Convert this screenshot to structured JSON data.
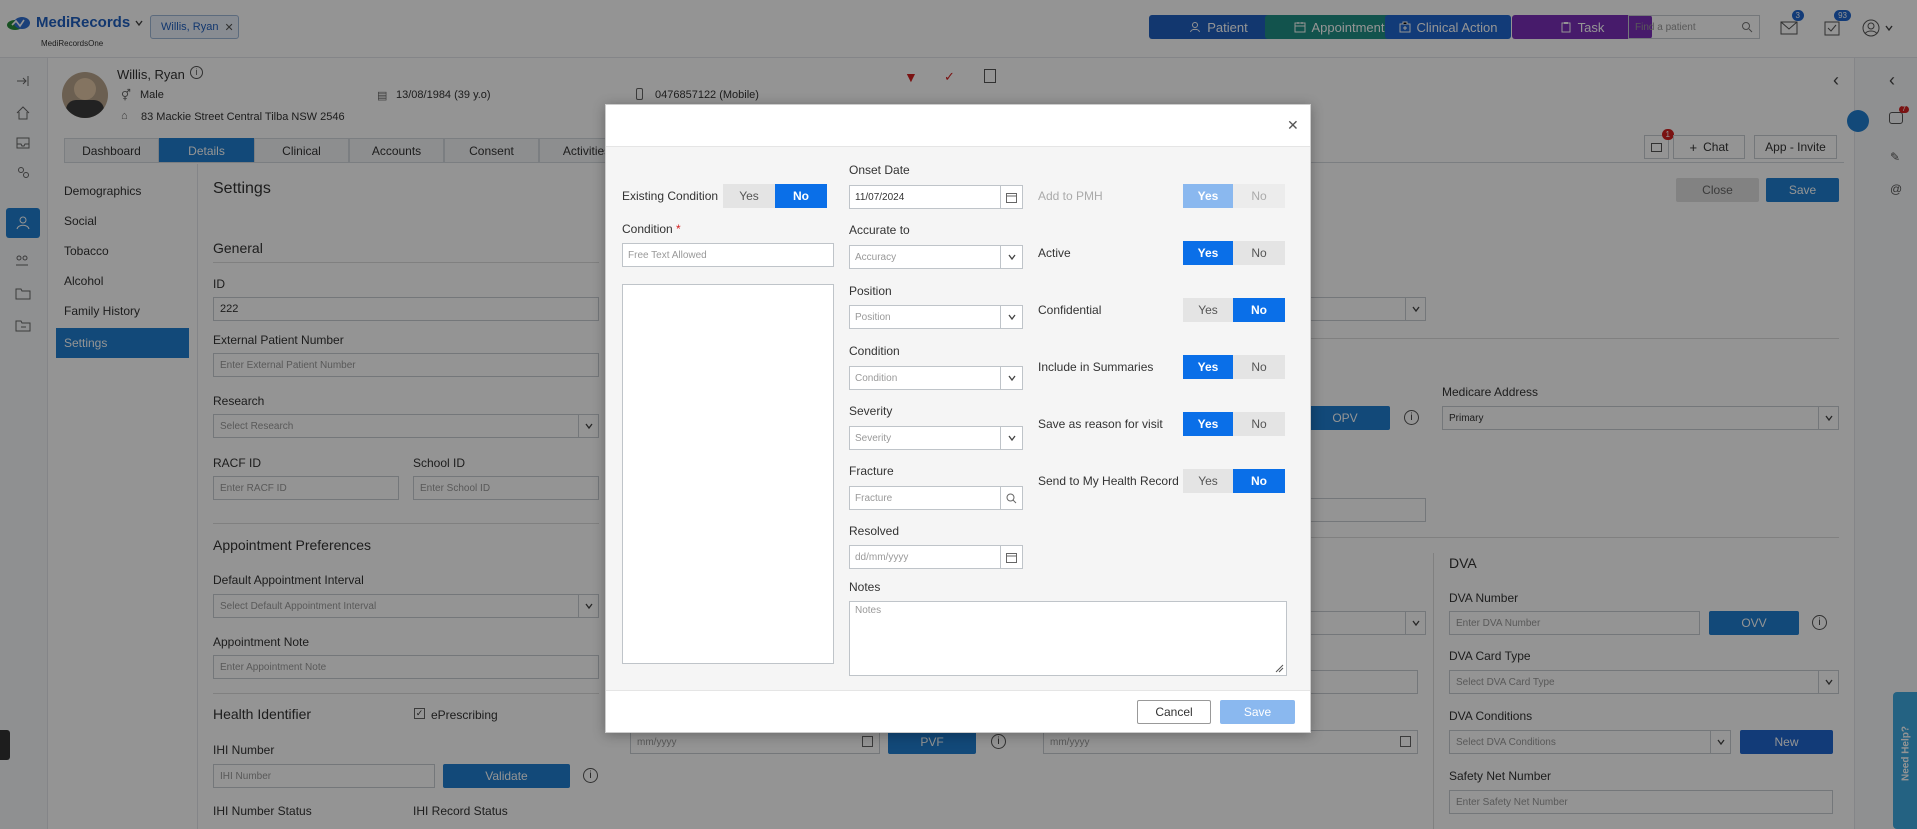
{
  "app": {
    "brand": "MediRecords",
    "sub_brand": "MediRecordsOne",
    "patient_tab": "Willis, Ryan"
  },
  "topbar": {
    "buttons": [
      {
        "label": "Patient",
        "color": "#1f5fbf"
      },
      {
        "label": "Appointment",
        "color": "#1f8f85"
      },
      {
        "label": "Clinical Action",
        "color": "#1f66cf"
      },
      {
        "label": "Task",
        "color": "#7a2fb8"
      }
    ],
    "search_placeholder": "Find a patient",
    "mail_badge": "3",
    "tasks_badge": "93"
  },
  "patient": {
    "name": "Willis, Ryan",
    "gender": "Male",
    "dob": "13/08/1984 (39 y.o)",
    "phone": "0476857122 (Mobile)",
    "address": "83 Mackie Street Central Tilba NSW 2546"
  },
  "tabs": [
    "Dashboard",
    "Details",
    "Clinical",
    "Accounts",
    "Consent",
    "Activities"
  ],
  "header_actions": {
    "chat": "Chat",
    "app_invite": "App - Invite",
    "notif_badge": "1"
  },
  "right_rail_badge": "7",
  "subnav": [
    "Demographics",
    "Social",
    "Tobacco",
    "Alcohol",
    "Family History",
    "Settings"
  ],
  "settings": {
    "title": "Settings",
    "close": "Close",
    "save": "Save",
    "general": "General",
    "id_label": "ID",
    "id_value": "222",
    "ext_label": "External Patient Number",
    "ext_ph": "Enter External Patient Number",
    "research_label": "Research",
    "research_ph": "Select Research",
    "racf_label": "RACF ID",
    "racf_ph": "Enter RACF ID",
    "school_label": "School ID",
    "school_ph": "Enter School ID",
    "appt_pref": "Appointment Preferences",
    "interval_label": "Default Appointment Interval",
    "interval_ph": "Select Default Appointment Interval",
    "note_label": "Appointment Note",
    "note_ph": "Enter Appointment Note",
    "health_id": "Health Identifier",
    "eprescribing": "ePrescribing",
    "ihi_label": "IHI Number",
    "ihi_ph": "IHI Number",
    "validate": "Validate",
    "ihi_status": "IHI Number Status",
    "ihi_record": "IHI Record Status",
    "opv": "OPV",
    "medicare_addr_label": "Medicare Address",
    "medicare_addr_value": "Primary",
    "dva": "DVA",
    "dva_num_label": "DVA Number",
    "dva_num_ph": "Enter DVA Number",
    "ovv": "OVV",
    "dva_card_label": "DVA Card Type",
    "dva_card_ph": "Select DVA Card Type",
    "dva_cond_label": "DVA Conditions",
    "dva_cond_ph": "Select DVA Conditions",
    "new": "New",
    "safety_label": "Safety Net Number",
    "safety_ph": "Enter Safety Net Number",
    "mmyyyy_1": "mm/yyyy",
    "pvf": "PVF",
    "mmyyyy_2": "mm/yyyy"
  },
  "need_help": "Need Help?",
  "modal": {
    "existing_condition": "Existing Condition",
    "yes": "Yes",
    "no": "No",
    "condition_label": "Condition",
    "required_mark": "*",
    "condition_ph": "Free Text Allowed",
    "onset_label": "Onset Date",
    "onset_value": "11/07/2024",
    "accurate_label": "Accurate to",
    "accuracy_ph": "Accuracy",
    "position_label": "Position",
    "position_ph": "Position",
    "condition2_label": "Condition",
    "condition2_ph": "Condition",
    "severity_label": "Severity",
    "severity_ph": "Severity",
    "fracture_label": "Fracture",
    "fracture_ph": "Fracture",
    "resolved_label": "Resolved",
    "resolved_ph": "dd/mm/yyyy",
    "notes_label": "Notes",
    "notes_ph": "Notes",
    "add_pmh": "Add to PMH",
    "active": "Active",
    "confidential": "Confidential",
    "include_summaries": "Include in Summaries",
    "save_reason": "Save as reason for visit",
    "send_mhr": "Send to My Health Record",
    "cancel": "Cancel",
    "save": "Save"
  }
}
